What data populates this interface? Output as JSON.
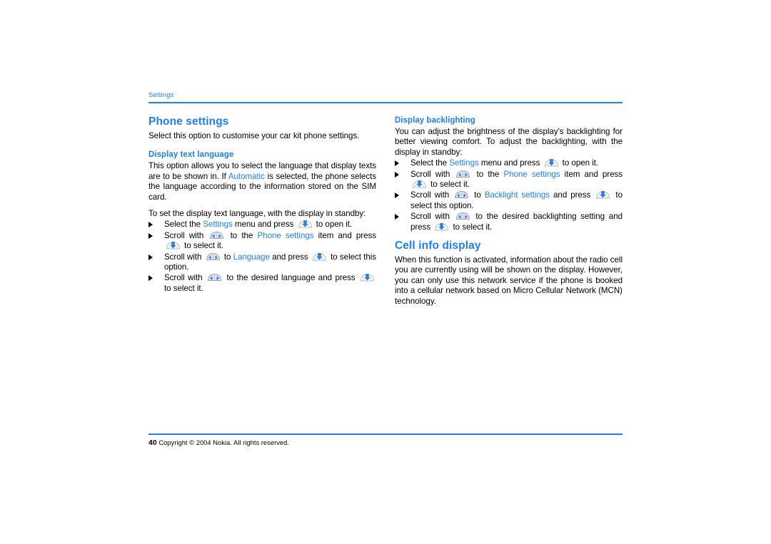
{
  "page": {
    "running_head": "Settings",
    "page_number": "40",
    "copyright": "Copyright © 2004 Nokia. All rights reserved."
  },
  "icons": {
    "scroll": "scroll-key-icon",
    "press": "select-key-icon",
    "bullet": "triangle-bullet-icon"
  },
  "colors": {
    "accent_blue": "#1f7ef0",
    "body_text": "#000000",
    "background": "#ffffff"
  },
  "left_column": {
    "chapter_title": "Phone settings",
    "intro": "Select this option to customise your car kit phone settings.",
    "section": {
      "heading": "Display text language",
      "paragraph_1_a": "This option allows you to select the language that display texts are to be shown in. If ",
      "paragraph_1_link": "Automatic",
      "paragraph_1_b": " is selected, the phone selects the language according to the information stored on the SIM card.",
      "paragraph_2": "To set the display text language, with the display in standby:",
      "steps": [
        {
          "t1": "Select the ",
          "link1": "Settings",
          "t2": " menu and press ",
          "icon1": "press",
          "t3": " to open it."
        },
        {
          "t1": "Scroll with ",
          "icon1": "scroll",
          "t2": " to the ",
          "link1": "Phone settings",
          "t3": " item and press ",
          "icon2": "press",
          "t4": " to select it."
        },
        {
          "t1": "Scroll with ",
          "icon1": "scroll",
          "t2": " to ",
          "link1": "Language",
          "t3": " and press ",
          "icon2": "press",
          "t4": " to select this option."
        },
        {
          "t1": "Scroll with ",
          "icon1": "scroll",
          "t2": " to the desired language and press ",
          "icon2": "press",
          "t3": " to select it."
        }
      ]
    }
  },
  "right_column": {
    "section_1": {
      "heading": "Display backlighting",
      "paragraph": "You can adjust the brightness of the display's backlighting for better viewing comfort. To adjust the backlighting, with the display in standby:",
      "steps": [
        {
          "t1": "Select the ",
          "link1": "Settings",
          "t2": " menu and press ",
          "icon1": "press",
          "t3": " to open it."
        },
        {
          "t1": "Scroll with ",
          "icon1": "scroll",
          "t2": " to the ",
          "link1": "Phone settings",
          "t3": " item and press ",
          "icon2": "press",
          "t4": " to select it."
        },
        {
          "t1": "Scroll with ",
          "icon1": "scroll",
          "t2": " to ",
          "link1": "Backlight settings",
          "t3": " and press ",
          "icon2": "press",
          "t4": " to select this option."
        },
        {
          "t1": "Scroll with ",
          "icon1": "scroll",
          "t2": " to the desired backlighting setting and press ",
          "icon2": "press",
          "t3": " to select it."
        }
      ]
    },
    "section_2": {
      "heading": "Cell info display",
      "paragraph": "When this function is activated, information about the radio cell you are currently using will be shown on the display. However, you can only use this network service if the phone is booked into a cellular network based on Micro Cellular Network (MCN) technology."
    }
  }
}
